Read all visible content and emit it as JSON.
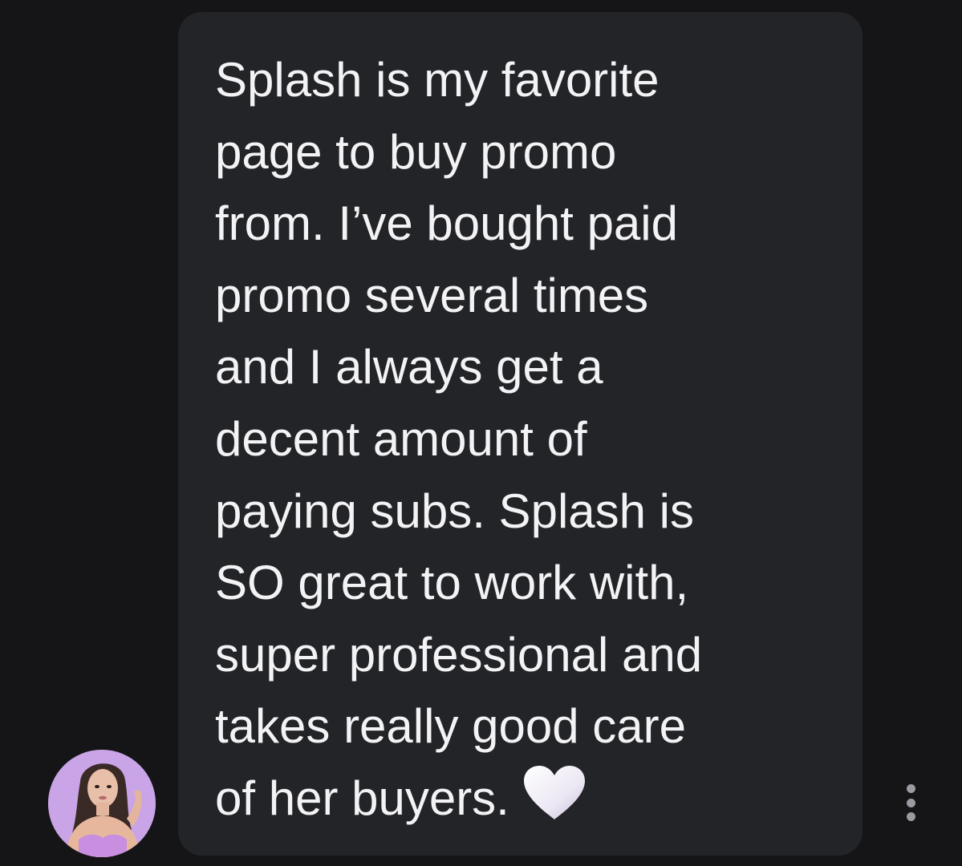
{
  "message": {
    "lines": [
      "Splash is my favorite",
      "page to buy promo",
      "from. I’ve bought paid",
      "promo several times",
      "and I always get a",
      "decent amount of",
      "paying subs. Splash is",
      "SO great to work with,",
      "super professional and",
      "takes really good care",
      "of her buyers."
    ],
    "emoji_icon": "white-heart-icon"
  },
  "sender": {
    "avatar_icon": "profile-photo"
  },
  "actions": {
    "more_icon": "vertical-ellipsis-icon"
  },
  "colors": {
    "background": "#151517",
    "bubble": "#232428",
    "text": "#f3f3f5",
    "avatar_bg": "#c9a4e6",
    "dots": "#9a9aa0"
  }
}
